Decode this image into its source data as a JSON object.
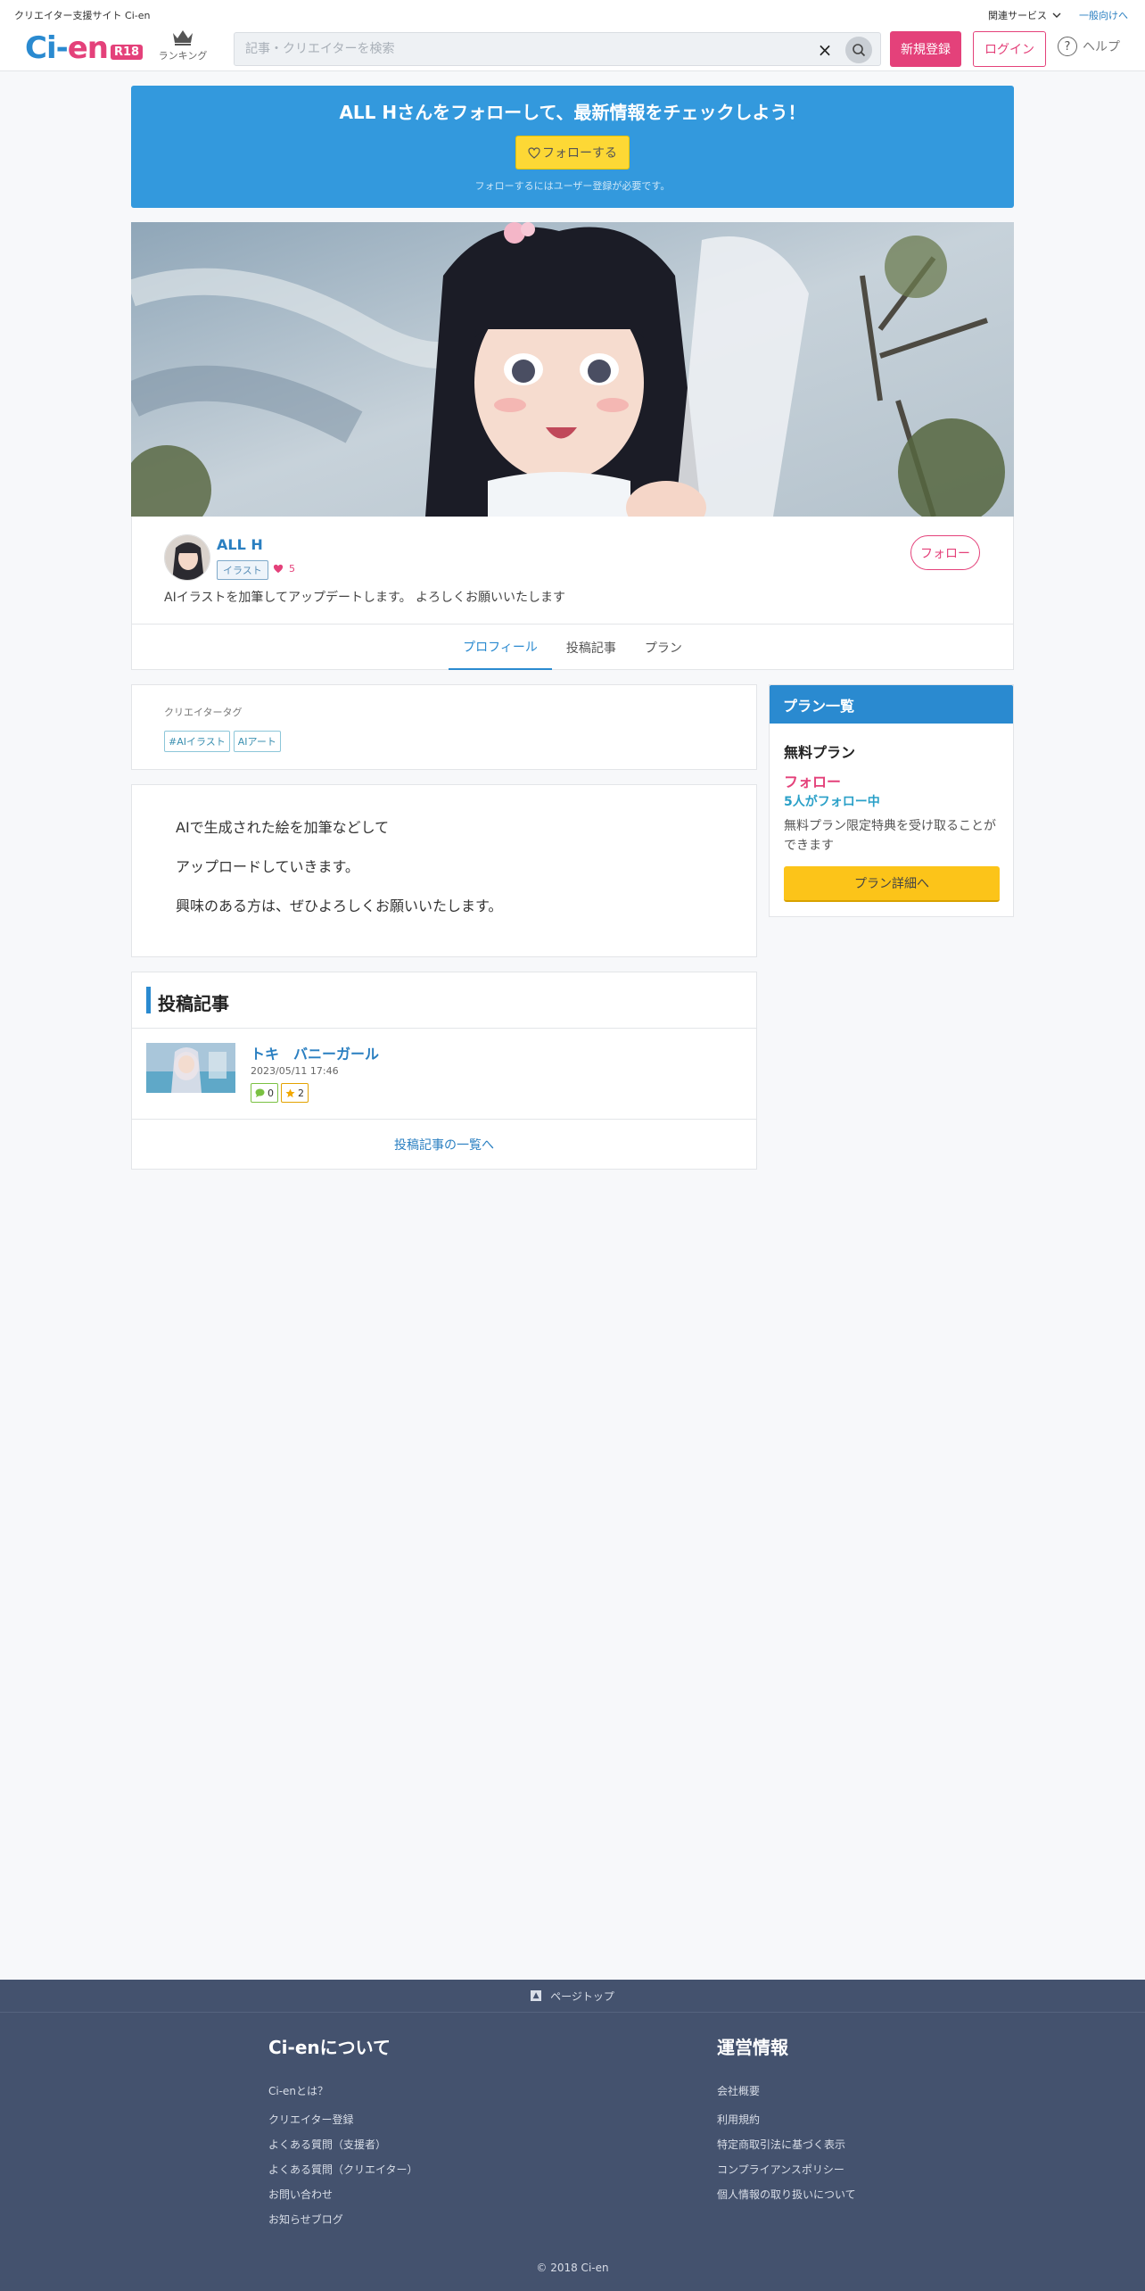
{
  "topbar": {
    "site_name": "クリエイター支援サイト Ci-en",
    "related_services": "関連サービス",
    "general_link": "一般向けへ"
  },
  "header": {
    "logo_main": "Ci-",
    "logo_en": "en",
    "logo_badge": "R18",
    "ranking_label": "ランキング",
    "search_placeholder": "記事・クリエイターを検索",
    "clear_symbol": "×",
    "register_label": "新規登録",
    "login_label": "ログイン",
    "help_symbol": "?",
    "help_label": "ヘルプ"
  },
  "follow_banner": {
    "title": "ALL Hさんをフォローして、最新情報をチェックしよう！",
    "button_label": "フォローする",
    "note": "フォローするにはユーザー登録が必要です。"
  },
  "creator": {
    "name": "ALL H",
    "category": "イラスト",
    "likes": "5",
    "description": "AIイラストを加筆してアップデートします。 よろしくお願いいたします",
    "follow_label": "フォロー"
  },
  "tabs": [
    {
      "label": "プロフィール",
      "active": true
    },
    {
      "label": "投稿記事",
      "active": false
    },
    {
      "label": "プラン",
      "active": false
    }
  ],
  "creator_tags": {
    "label": "クリエイタータグ",
    "tags": [
      "#AIイラスト",
      "AIアート"
    ]
  },
  "profile_text": [
    "AIで生成された絵を加筆などして",
    "アップロードしていきます。",
    "興味のある方は、ぜひよろしくお願いいたします。"
  ],
  "posts": {
    "heading": "投稿記事",
    "items": [
      {
        "title": "トキ　バニーガール",
        "date": "2023/05/11 17:46",
        "comments": "0",
        "stars": "2"
      }
    ],
    "more_label": "投稿記事の一覧へ"
  },
  "plans": {
    "heading": "プラン一覧",
    "name": "無料プラン",
    "follow_label": "フォロー",
    "follower_count": "5人がフォロー中",
    "description": "無料プラン限定特典を受け取ることができます",
    "button_label": "プラン詳細へ"
  },
  "footer": {
    "pagetop_label": "ページトップ",
    "about_heading": "Ci-enについて",
    "about_links": [
      "Ci-enとは？",
      "クリエイター登録",
      "よくある質問（支援者）",
      "よくある質問（クリエイター）",
      "お問い合わせ",
      "お知らせブログ"
    ],
    "ops_heading": "運営情報",
    "ops_links": [
      "会社概要",
      "利用規約",
      "特定商取引法に基づく表示",
      "コンプライアンスポリシー",
      "個人情報の取り扱いについて"
    ],
    "copyright": "© 2018 Ci-en"
  },
  "colors": {
    "brand_blue": "#2a8ad0",
    "brand_pink": "#e4417a",
    "banner_blue": "#3399dd",
    "plan_yellow": "#fcc419",
    "footer_bg": "#44526e"
  },
  "icons": [
    "chevron-down-icon",
    "crown-icon",
    "close-icon",
    "search-icon",
    "help-icon",
    "heart-icon",
    "comment-icon",
    "star-icon",
    "arrow-up-icon"
  ]
}
